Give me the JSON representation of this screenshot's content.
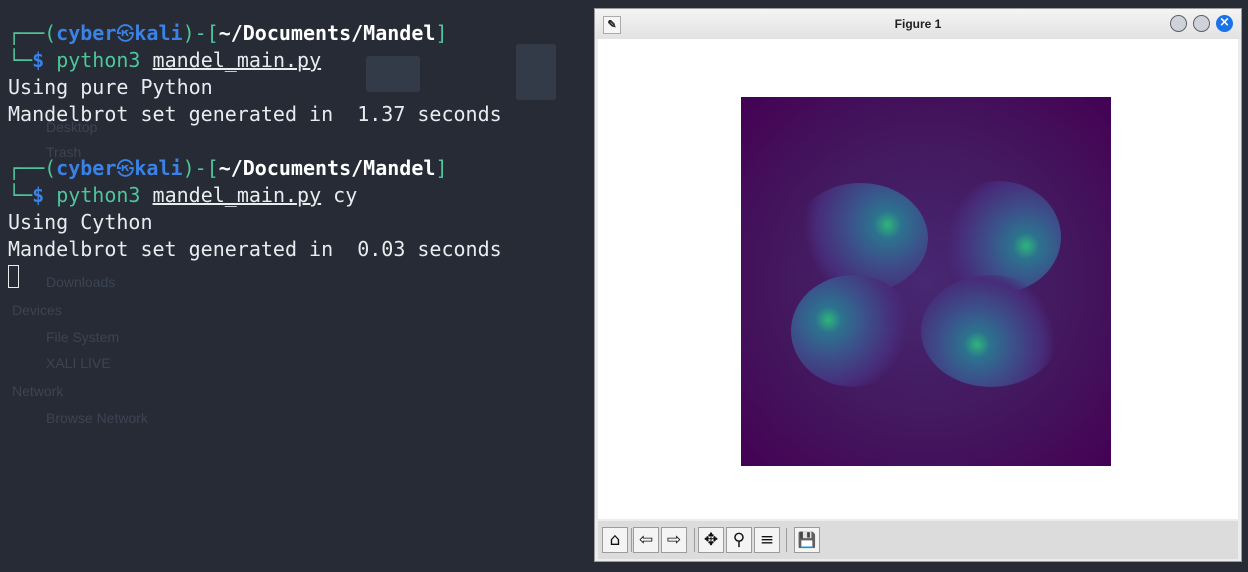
{
  "terminal": {
    "blocks": [
      {
        "user": "cyber",
        "host": "kali",
        "path": "~/Documents/Mandel",
        "prompt_symbol": "$",
        "command": "python3",
        "command_arg": "mandel_main.py",
        "extra_arg": "",
        "output": [
          "Using pure Python",
          "Mandelbrot set generated in  1.37 seconds"
        ]
      },
      {
        "user": "cyber",
        "host": "kali",
        "path": "~/Documents/Mandel",
        "prompt_symbol": "$",
        "command": "python3",
        "command_arg": "mandel_main.py",
        "extra_arg": "cy",
        "output": [
          "Using Cython",
          "Mandelbrot set generated in  0.03 seconds"
        ]
      }
    ]
  },
  "background_file_manager": {
    "items": [
      "Desktop",
      "Trash",
      "Downloads",
      "Devices",
      "File System",
      "XALI LIVE",
      "Network",
      "Browse Network"
    ]
  },
  "figure": {
    "title": "Figure 1",
    "colors": {
      "plot_bg": "#440154",
      "accent": "#1a73e8"
    },
    "toolbar": [
      {
        "name": "home-button",
        "icon": "⌂"
      },
      {
        "name": "back-button",
        "icon": "⇦"
      },
      {
        "name": "forward-button",
        "icon": "⇨"
      },
      {
        "name": "pan-button",
        "icon": "✥"
      },
      {
        "name": "zoom-button",
        "icon": "⚲"
      },
      {
        "name": "configure-subplots-button",
        "icon": "≡"
      },
      {
        "name": "save-button",
        "icon": "💾"
      }
    ]
  }
}
